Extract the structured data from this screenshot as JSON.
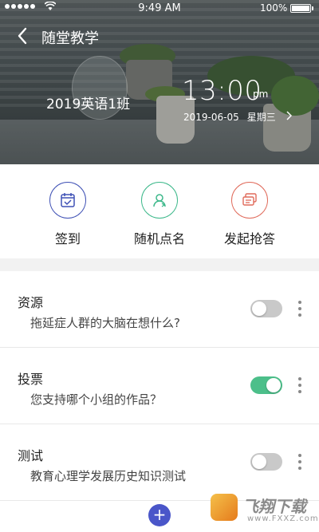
{
  "status_bar": {
    "time": "9:49 AM",
    "battery_text": "100%"
  },
  "navbar": {
    "title": "随堂教学",
    "back_icon": "chevron-left-icon"
  },
  "hero": {
    "class_name": "2019英语1班",
    "time": "13:00",
    "ampm": "pm",
    "date": "2019-06-05",
    "weekday": "星期三"
  },
  "actions": [
    {
      "label": "签到",
      "icon": "calendar-check-icon",
      "color": "#3f51b5"
    },
    {
      "label": "随机点名",
      "icon": "user-random-icon",
      "color": "#3cb88a"
    },
    {
      "label": "发起抢答",
      "icon": "chat-bubbles-icon",
      "color": "#e06a5a"
    }
  ],
  "list": [
    {
      "title": "资源",
      "subtitle": "拖延症人群的大脑在想什么?",
      "toggle": "off"
    },
    {
      "title": "投票",
      "subtitle": "您支持哪个小组的作品？",
      "toggle": "on"
    },
    {
      "title": "测试",
      "subtitle": "教育心理学发展历史知识测试",
      "toggle": "off"
    }
  ],
  "fab": {
    "label": "+"
  },
  "watermark": {
    "text": "飞翔下载",
    "url": "www.FXXZ.com"
  },
  "colors": {
    "accent": "#4a56c9",
    "toggle_on": "#4cbf8a",
    "toggle_off": "#c9c9c9"
  }
}
